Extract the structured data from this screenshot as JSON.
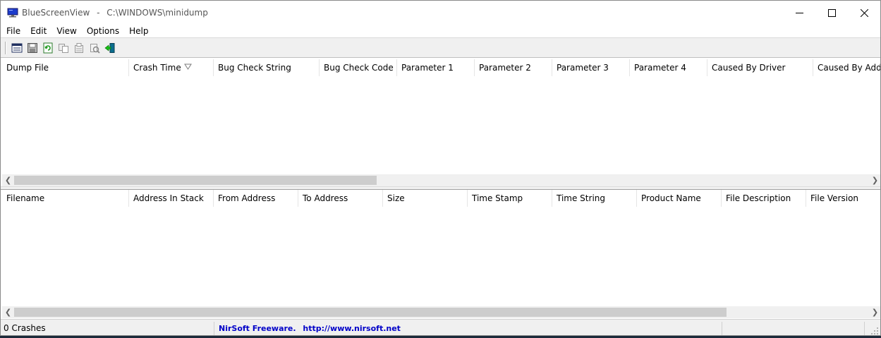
{
  "window": {
    "app_name": "BlueScreenView",
    "separator": "-",
    "path": "C:\\WINDOWS\\minidump"
  },
  "menu": [
    {
      "label": "File"
    },
    {
      "label": "Edit"
    },
    {
      "label": "View"
    },
    {
      "label": "Options"
    },
    {
      "label": "Help"
    }
  ],
  "toolbar": {
    "buttons": [
      {
        "icon": "html-report-icon"
      },
      {
        "icon": "save-icon"
      },
      {
        "icon": "refresh-icon"
      },
      {
        "icon": "copy-icon"
      },
      {
        "icon": "properties-icon"
      },
      {
        "icon": "advanced-options-icon"
      },
      {
        "icon": "exit-icon"
      }
    ]
  },
  "crash_list": {
    "columns": [
      {
        "label": "Dump File"
      },
      {
        "label": "Crash Time"
      },
      {
        "label": "Bug Check String"
      },
      {
        "label": "Bug Check Code"
      },
      {
        "label": "Parameter 1"
      },
      {
        "label": "Parameter 2"
      },
      {
        "label": "Parameter 3"
      },
      {
        "label": "Parameter 4"
      },
      {
        "label": "Caused By Driver"
      },
      {
        "label": "Caused By Address"
      }
    ],
    "sorted_column": "Crash Time",
    "rows": []
  },
  "driver_list": {
    "columns": [
      {
        "label": "Filename"
      },
      {
        "label": "Address In Stack"
      },
      {
        "label": "From Address"
      },
      {
        "label": "To Address"
      },
      {
        "label": "Size"
      },
      {
        "label": "Time Stamp"
      },
      {
        "label": "Time String"
      },
      {
        "label": "Product Name"
      },
      {
        "label": "File Description"
      },
      {
        "label": "File Version"
      }
    ],
    "rows": []
  },
  "status": {
    "crash_count": "0 Crashes",
    "freeware_label": "NirSoft Freeware.",
    "url": "http://www.nirsoft.net"
  },
  "colors": {
    "link": "#0000c8",
    "toolbar_bg": "#f0f0f0"
  }
}
